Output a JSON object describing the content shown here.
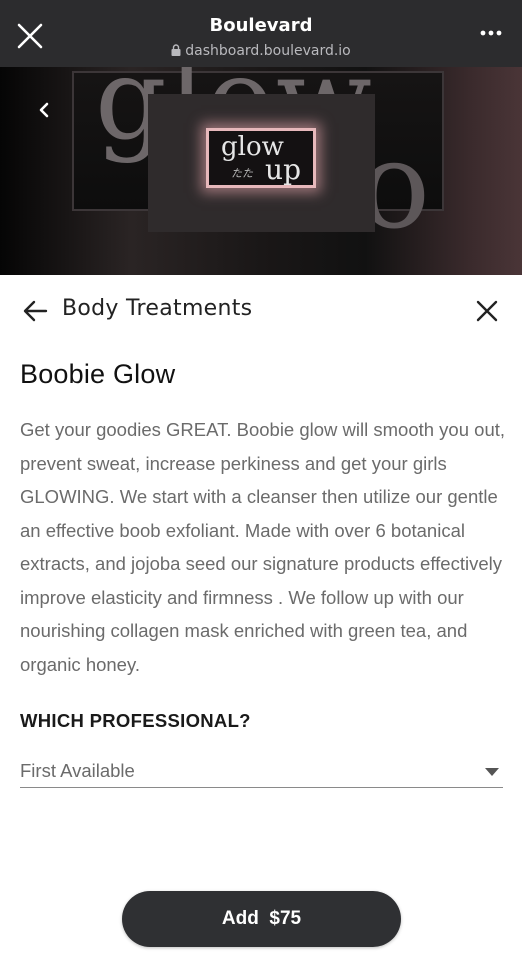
{
  "browser": {
    "title": "Boulevard",
    "url": "dashboard.boulevard.io",
    "close_icon": "close-icon",
    "more_icon": "more-horizontal-icon"
  },
  "hero": {
    "watermark": "glow",
    "watermark_tail": "o",
    "logo_top": "glow",
    "logo_mid": "たた",
    "logo_bottom": "up"
  },
  "panel": {
    "category": "Body Treatments",
    "service_title": "Boobie Glow",
    "description": "Get your goodies GREAT. Boobie glow will smooth you out, prevent sweat, increase perkiness and get your girls GLOWING. We start with a cleanser then utilize our gentle an effective boob exfoliant. Made with over 6 botanical extracts, and jojoba seed our signature products effectively improve elasticity and firmness . We follow up with our nourishing collagen mask enriched with green tea, and organic honey.",
    "professional_label": "WHICH PROFESSIONAL?",
    "professional_value": "First Available",
    "add_label": "Add",
    "price": "$75"
  },
  "colors": {
    "browser_bar": "#2c2c2e",
    "button_bg": "#2f3033",
    "text_muted": "#6b6b6b",
    "logo_glow": "#e7b8bb"
  }
}
